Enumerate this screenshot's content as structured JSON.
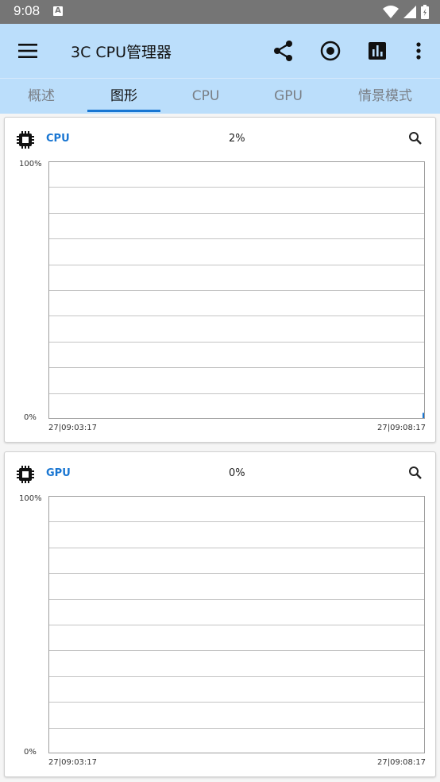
{
  "status_bar": {
    "time": "9:08",
    "notification_letter": "A"
  },
  "app_bar": {
    "title": "3C CPU管理器"
  },
  "tabs": [
    {
      "label": "概述"
    },
    {
      "label": "图形",
      "active": true
    },
    {
      "label": "CPU"
    },
    {
      "label": "GPU"
    },
    {
      "label": "情景模式"
    }
  ],
  "graphs": [
    {
      "name": "CPU",
      "value": "2%",
      "y_max_label": "100%",
      "y_min_label": "0%",
      "x_start_label": "27|09:03:17",
      "x_end_label": "27|09:08:17",
      "latest_value_percent": 2
    },
    {
      "name": "GPU",
      "value": "0%",
      "y_max_label": "100%",
      "y_min_label": "0%",
      "x_start_label": "27|09:03:17",
      "x_end_label": "27|09:08:17",
      "latest_value_percent": 0
    }
  ],
  "colors": {
    "accent": "#1976d2",
    "appbar": "#bbdefb",
    "statusbar": "#757575"
  },
  "icons": [
    "menu-icon",
    "share-icon",
    "record-icon",
    "chart-icon",
    "more-vert-icon",
    "chip-icon",
    "search-icon"
  ]
}
